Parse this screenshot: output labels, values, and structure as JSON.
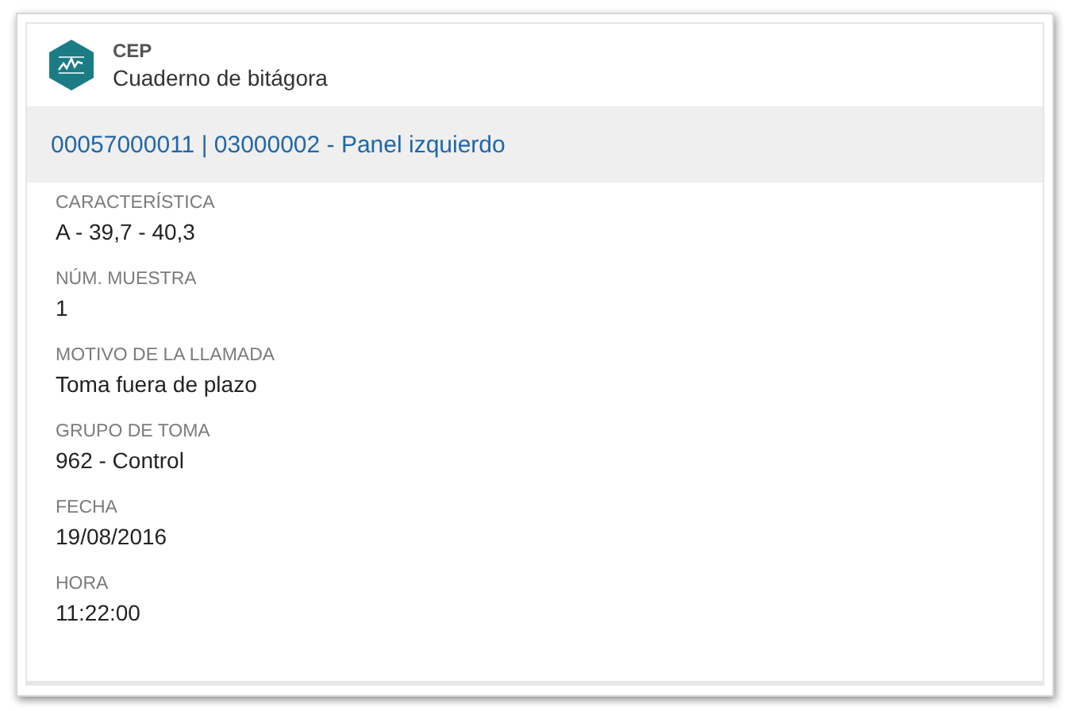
{
  "header": {
    "app": "CEP",
    "title": "Cuaderno de bitágora"
  },
  "banner": {
    "text": "00057000011 | 03000002 - Panel izquierdo"
  },
  "fields": [
    {
      "label": "CARACTERÍSTICA",
      "value": "A - 39,7 - 40,3"
    },
    {
      "label": "NÚM. MUESTRA",
      "value": "1"
    },
    {
      "label": "MOTIVO DE LA LLAMADA",
      "value": "Toma fuera de plazo"
    },
    {
      "label": "GRUPO DE TOMA",
      "value": "962 - Control"
    },
    {
      "label": "FECHA",
      "value": "19/08/2016"
    },
    {
      "label": "HORA",
      "value": "11:22:00"
    }
  ]
}
